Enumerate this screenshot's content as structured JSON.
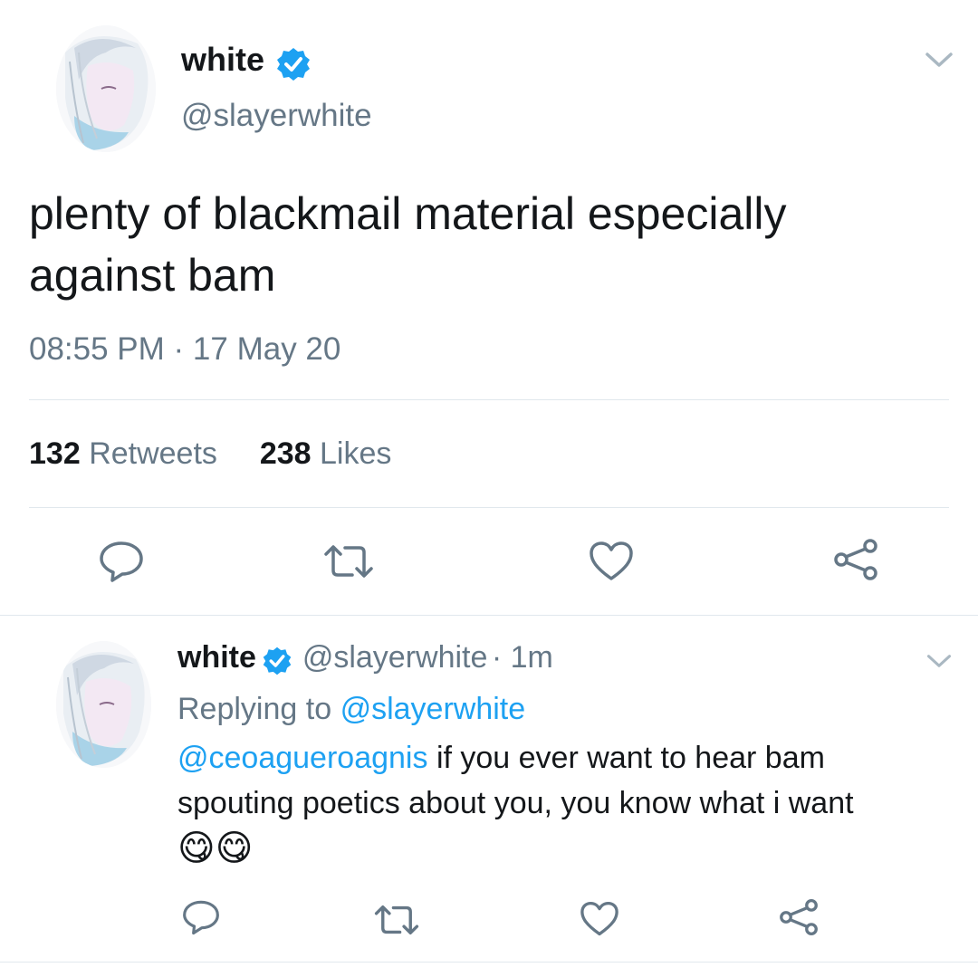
{
  "main_tweet": {
    "display_name": "white",
    "handle": "@slayerwhite",
    "text_line1": "plenty of blackmail material especially",
    "text_line2": "against bam",
    "timestamp": "08:55 PM · 17 May 20",
    "retweet_count": "132",
    "retweet_label": "Retweets",
    "like_count": "238",
    "like_label": "Likes"
  },
  "reply_tweet": {
    "display_name": "white",
    "handle": "@slayerwhite",
    "time_ago": "· 1m",
    "replying_prefix": "Replying to",
    "replying_handle": "@slayerwhite",
    "mention": "@ceoagueroagnis",
    "text_line1_rest": "if you ever want to hear bam",
    "text_line2": "spouting poetics about you, you know what i want",
    "emojis": "😋😋"
  },
  "icons": {
    "reply": "reply-icon",
    "retweet": "retweet-icon",
    "like": "heart-icon",
    "share": "share-icon",
    "verified": "verified-badge-icon",
    "menu": "chevron-down-icon"
  },
  "colors": {
    "accent": "#1da1f2",
    "text": "#14171a",
    "muted": "#657786",
    "divider": "#e1e8ed"
  }
}
